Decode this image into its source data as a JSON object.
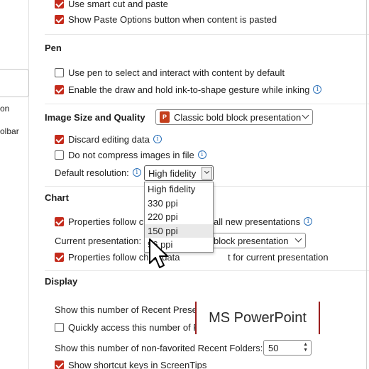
{
  "sidebar": {
    "items": [
      {
        "label": "on"
      },
      {
        "label": "olbar"
      }
    ]
  },
  "editing": {
    "smart_cut": {
      "label": "Use smart cut and paste",
      "checked": true
    },
    "show_paste": {
      "label": "Show Paste Options button when content is pasted",
      "checked": true
    }
  },
  "pen": {
    "header": "Pen",
    "use_pen": {
      "label": "Use pen to select and interact with content by default",
      "checked": false
    },
    "ink_shape": {
      "label": "Enable the draw and hold ink-to-shape gesture while inking",
      "checked": true
    }
  },
  "image_size": {
    "header": "Image Size and Quality",
    "presentation": "Classic bold block presentation",
    "discard": {
      "label": "Discard editing data",
      "checked": true
    },
    "no_compress": {
      "label": "Do not compress images in file",
      "checked": false
    },
    "resolution_label": "Default resolution:",
    "resolution_value": "High fidelity",
    "resolution_options": [
      "High fidelity",
      "330 ppi",
      "220 ppi",
      "150 ppi",
      "96 ppi"
    ],
    "hovered_option": "150 ppi"
  },
  "chart": {
    "header": "Chart",
    "props_all_before": "Properties follow ch",
    "props_all_after": "all new presentations",
    "current_label": "Current presentation:",
    "current_value": "block presentation",
    "props_current_before": "Properties follow chart data",
    "props_current_after": "t for current presentation"
  },
  "display": {
    "header": "Display",
    "recent_presentations_label": "Show this number of Recent Presentations:",
    "quick_access_label": "Quickly access this number of Recent Pr",
    "recent_folders_label": "Show this number of non-favorited Recent Folders:",
    "recent_folders_value": "50",
    "shortcut_keys": {
      "label": "Show shortcut keys in ScreenTips",
      "checked": true
    }
  },
  "watermark": "MS PowerPoint",
  "colors": {
    "accent": "#c42b1c",
    "info": "#2a6fb8",
    "watermark_bar": "#9a1e1e"
  },
  "icons": {
    "info": "info-circle-icon",
    "checkbox_checked": "checkmark-icon",
    "app": "powerpoint-icon",
    "cursor": "arrow-cursor-icon"
  }
}
